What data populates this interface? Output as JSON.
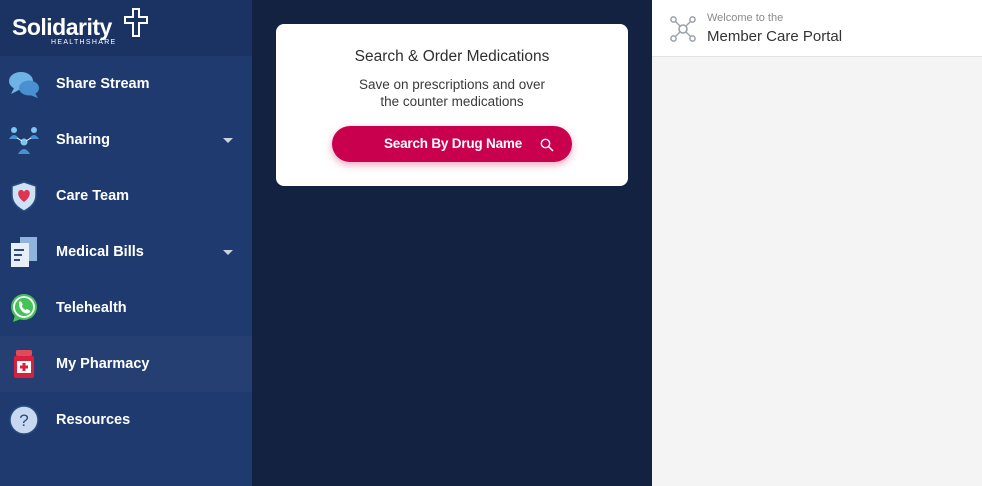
{
  "brand": {
    "name": "Solidarity",
    "subtitle": "HEALTHSHARE"
  },
  "sidebar": {
    "items": [
      {
        "label": "Share Stream",
        "icon": "chat-bubbles-icon",
        "has_caret": false,
        "active": false
      },
      {
        "label": "Sharing",
        "icon": "people-network-icon",
        "has_caret": true,
        "active": false
      },
      {
        "label": "Care Team",
        "icon": "heart-shield-icon",
        "has_caret": false,
        "active": false
      },
      {
        "label": "Medical Bills",
        "icon": "documents-icon",
        "has_caret": true,
        "active": false
      },
      {
        "label": "Telehealth",
        "icon": "phone-chat-icon",
        "has_caret": false,
        "active": false
      },
      {
        "label": "My Pharmacy",
        "icon": "pill-bottle-icon",
        "has_caret": false,
        "active": true
      },
      {
        "label": "Resources",
        "icon": "question-icon",
        "has_caret": false,
        "active": false
      }
    ]
  },
  "card": {
    "title": "Search & Order Medications",
    "description": "Save on prescriptions and over the counter medications",
    "button_label": "Search By Drug Name",
    "button_icon": "search-icon"
  },
  "header": {
    "welcome": "Welcome to the",
    "title": "Member Care Portal",
    "icon": "network-icon"
  },
  "colors": {
    "sidebar": "#1f3a6e",
    "main_bg": "#132240",
    "accent": "#c8004d",
    "panel_bg": "#f4f4f4"
  }
}
